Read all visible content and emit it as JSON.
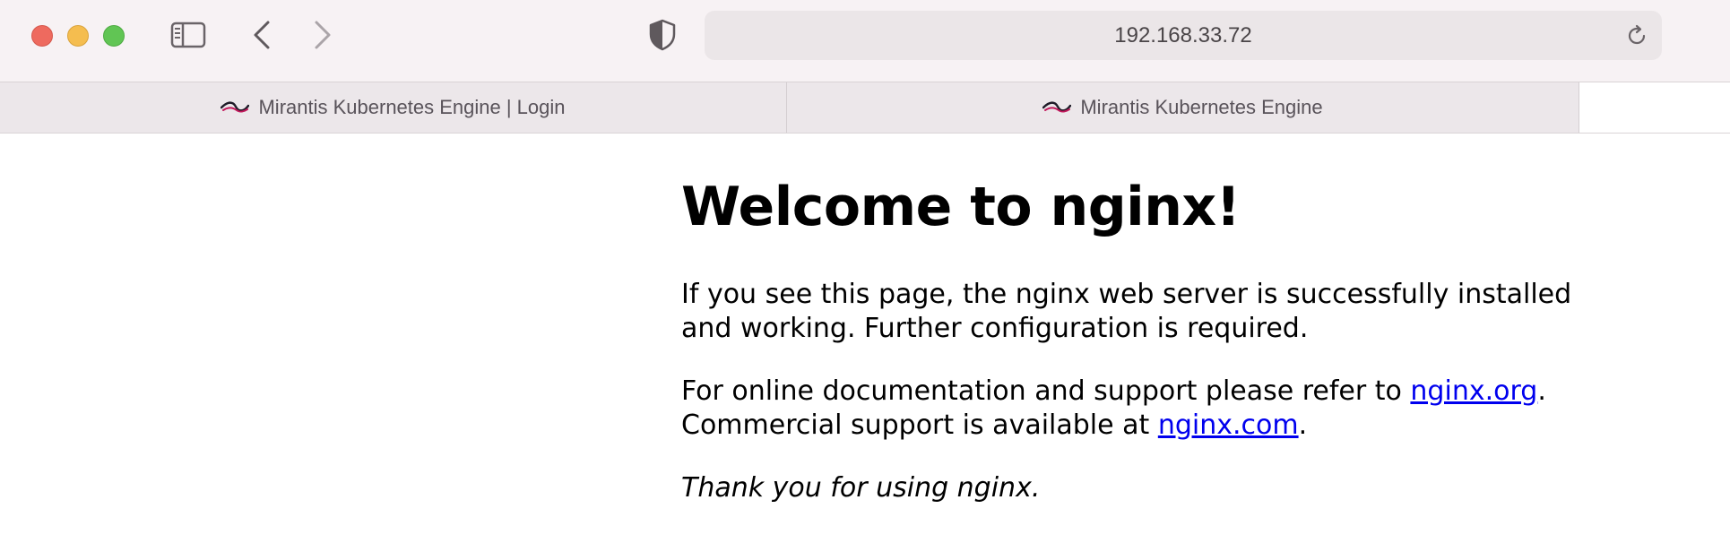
{
  "browser": {
    "url": "192.168.33.72",
    "tabs": [
      {
        "label": "Mirantis Kubernetes Engine | Login"
      },
      {
        "label": "Mirantis Kubernetes Engine"
      }
    ],
    "colors": {
      "close": "#ee6a5f",
      "minimize": "#f5bd4f",
      "zoom": "#61c554",
      "toolbar": "#f7f2f4",
      "link": "#0000ee"
    }
  },
  "page": {
    "heading": "Welcome to nginx!",
    "para1": "If you see this page, the nginx web server is successfully installed and working. Further configuration is required.",
    "para2_before": "For online documentation and support please refer to ",
    "link_org": "nginx.org",
    "para2_mid": ".",
    "para2_line2": "Commercial support is available at ",
    "link_com": "nginx.com",
    "para2_end": ".",
    "thanks": "Thank you for using nginx."
  }
}
